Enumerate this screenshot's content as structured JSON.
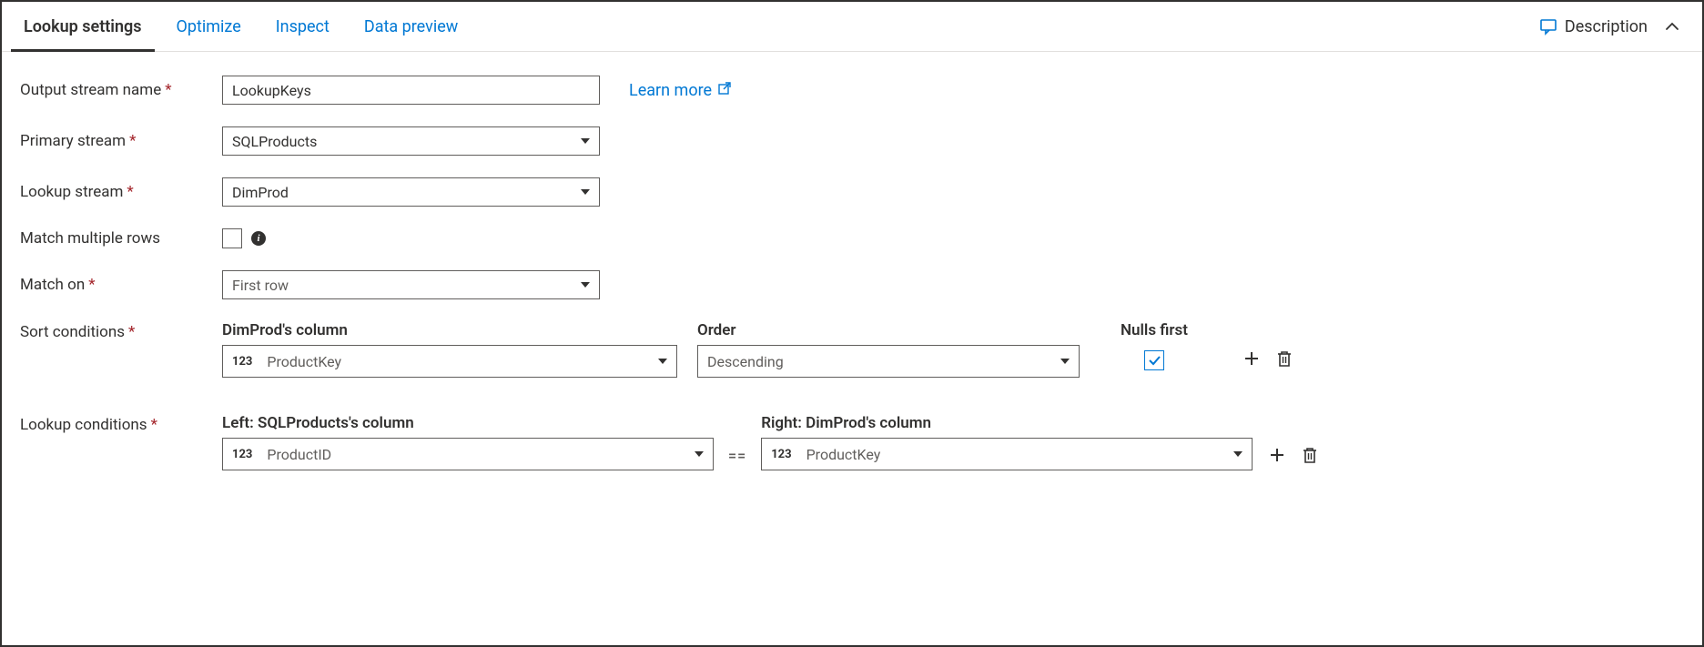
{
  "tabs": {
    "lookup_settings": "Lookup settings",
    "optimize": "Optimize",
    "inspect": "Inspect",
    "data_preview": "Data preview"
  },
  "header": {
    "description": "Description"
  },
  "labels": {
    "output_stream_name": "Output stream name",
    "primary_stream": "Primary stream",
    "lookup_stream": "Lookup stream",
    "match_multiple_rows": "Match multiple rows",
    "match_on": "Match on",
    "sort_conditions": "Sort conditions",
    "lookup_conditions": "Lookup conditions",
    "learn_more": "Learn more"
  },
  "values": {
    "output_stream_name": "LookupKeys",
    "primary_stream": "SQLProducts",
    "lookup_stream": "DimProd",
    "match_multiple_rows": false,
    "match_on": "First row"
  },
  "sort": {
    "column_header": "DimProd's column",
    "order_header": "Order",
    "nulls_first_header": "Nulls first",
    "column_type": "123",
    "column_value": "ProductKey",
    "order_value": "Descending",
    "nulls_first": true
  },
  "lookup": {
    "left_header": "Left: SQLProducts's column",
    "right_header": "Right: DimProd's column",
    "equals": "==",
    "left_type": "123",
    "left_value": "ProductID",
    "right_type": "123",
    "right_value": "ProductKey"
  }
}
